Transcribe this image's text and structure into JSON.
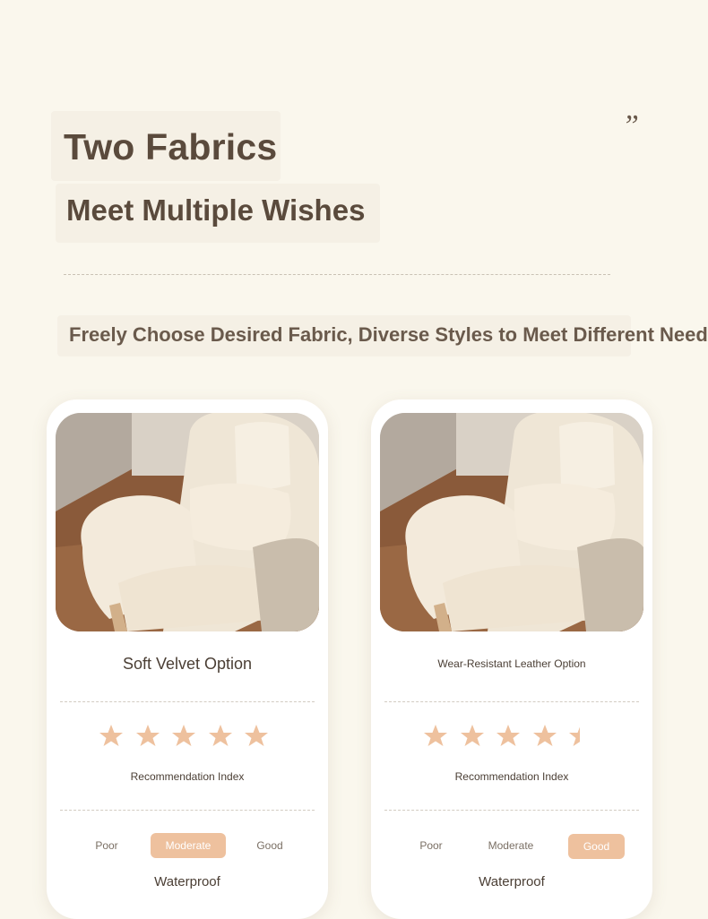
{
  "header": {
    "title": "Two Fabrics",
    "subtitle": "Meet Multiple Wishes",
    "quote_mark": "”",
    "tagline": "Freely Choose Desired Fabric, Diverse Styles to Meet Different Needs"
  },
  "cards": [
    {
      "option_name": "Soft Velvet Option",
      "rating_label": "Recommendation Index",
      "stars": 5,
      "scale": [
        "Poor",
        "Moderate",
        "Good"
      ],
      "selected": "Moderate",
      "attribute": "Waterproof"
    },
    {
      "option_name": "Wear-Resistant Leather Option",
      "rating_label": "Recommendation Index",
      "stars": 4.5,
      "scale": [
        "Poor",
        "Moderate",
        "Good"
      ],
      "selected": "Good",
      "attribute": "Waterproof"
    }
  ],
  "colors": {
    "background": "#faf7ed",
    "heading": "#5a4a3c",
    "star": "#eec19e",
    "selected_badge": "#eec19e"
  }
}
